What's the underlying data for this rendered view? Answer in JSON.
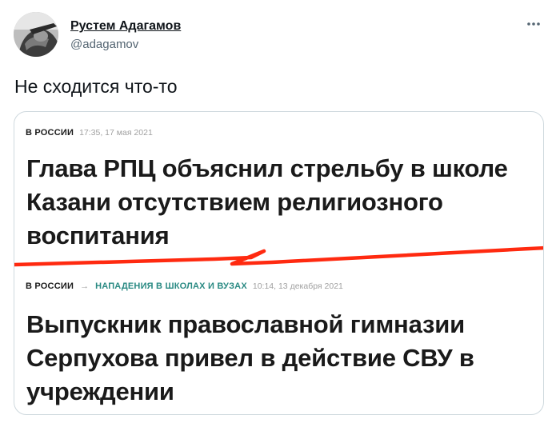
{
  "author": {
    "name": "Рустем Адагамов",
    "handle": "@adagamov"
  },
  "tweet": {
    "text": "Не сходится что-то"
  },
  "card": {
    "article1": {
      "rubric": "В РОССИИ",
      "time": "17:35, 17 мая 2021",
      "headline_lines": [
        "Глава РПЦ объяснил стрельбу в школе",
        "Казани отсутствием религиозного",
        "воспитания"
      ]
    },
    "article2": {
      "rubric": "В РОССИИ",
      "arrow": "→",
      "section": "НАПАДЕНИЯ В ШКОЛАХ И ВУЗАХ",
      "time": "10:14, 13 декабря 2021",
      "headline_lines": [
        "Выпускник православной гимназии",
        "Серпухова привел в действие СВУ в",
        "учреждении"
      ]
    },
    "divider_color": "#ff2a10"
  },
  "icons": {
    "more": "more-horizontal-icon",
    "avatar": "avatar-image"
  }
}
